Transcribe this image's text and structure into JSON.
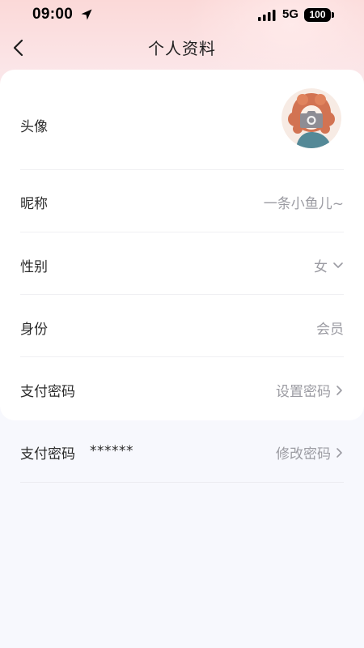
{
  "status_bar": {
    "time": "09:00",
    "network": "5G",
    "battery": "100",
    "icons": [
      "location-arrow-icon",
      "signal-icon",
      "battery-icon"
    ]
  },
  "nav": {
    "back_icon": "chevron-left-icon",
    "title": "个人资料"
  },
  "profile": {
    "avatar": {
      "label": "头像",
      "icon": "camera-icon"
    },
    "nickname": {
      "label": "昵称",
      "value": "一条小鱼儿~"
    },
    "gender": {
      "label": "性别",
      "value": "女",
      "icon": "chevron-down-icon"
    },
    "identity": {
      "label": "身份",
      "value": "会员"
    },
    "pay_password_set": {
      "label": "支付密码",
      "action": "设置密码",
      "icon": "chevron-right-icon"
    },
    "pay_password_modify": {
      "label": "支付密码",
      "mask": "******",
      "action": "修改密码",
      "icon": "chevron-right-icon"
    }
  },
  "colors": {
    "header_gradient_top": "#fbd9d8",
    "page_bg": "#f7f8fd",
    "card_bg": "#ffffff",
    "label_text": "#2b2b2b",
    "value_text": "#9b9ba2",
    "divider": "#f0f0f3"
  }
}
